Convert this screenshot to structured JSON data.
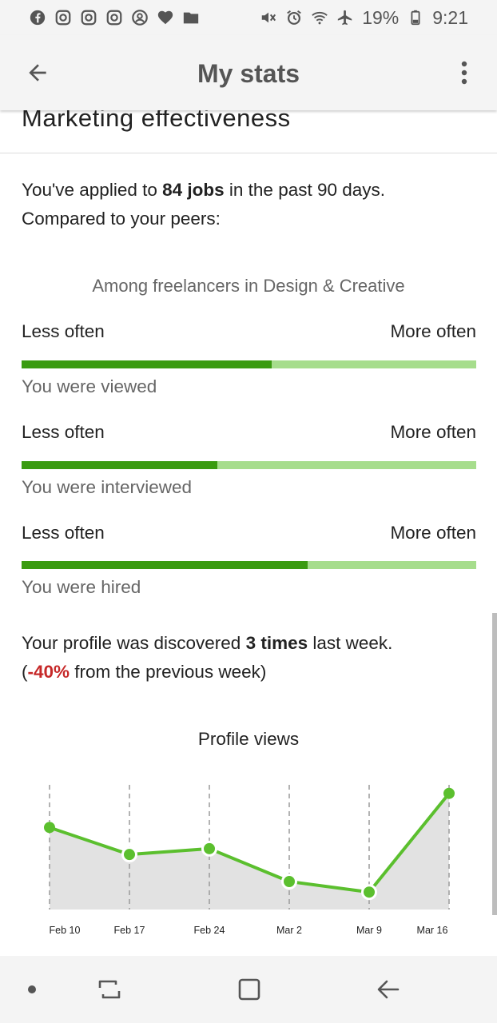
{
  "status_bar": {
    "battery": "19%",
    "time": "9:21",
    "left_icons": [
      "facebook-icon",
      "instagram-icon",
      "instagram-icon",
      "instagram-icon",
      "account-circle-icon",
      "heart-icon",
      "folder-icon"
    ],
    "right_icons": [
      "mute-icon",
      "alarm-icon",
      "wifi-icon",
      "airplane-icon",
      "battery-icon"
    ]
  },
  "app_bar": {
    "title": "My stats"
  },
  "section": {
    "title": "Marketing effectiveness"
  },
  "intro": {
    "prefix": "You've applied to ",
    "jobs": "84 jobs",
    "suffix": " in the past 90 days.",
    "line2": "Compared to your peers:"
  },
  "peers": {
    "caption": "Among freelancers in Design & Creative",
    "metrics": [
      {
        "low_label": "Less often",
        "high_label": "More often",
        "level": 0.55,
        "caption": "You were viewed"
      },
      {
        "low_label": "Less often",
        "high_label": "More often",
        "level": 0.43,
        "caption": "You were interviewed"
      },
      {
        "low_label": "Less often",
        "high_label": "More often",
        "level": 0.63,
        "caption": "You were hired"
      }
    ]
  },
  "discovered": {
    "prefix": "Your profile was discovered ",
    "times": "3 times",
    "suffix": " last week.",
    "open_paren": "(",
    "change": "-40%",
    "change_suffix": " from the previous week)"
  },
  "colors": {
    "bar_fill": "#3a9b10",
    "bar_track": "#a6dd8c",
    "line": "#5bbf2e",
    "negative": "#c62828"
  },
  "chart_data": {
    "type": "line",
    "title": "Profile views",
    "categories": [
      "Feb 10",
      "Feb 17",
      "Feb 24",
      "Mar 2",
      "Mar 9",
      "Mar 16"
    ],
    "values": [
      7.1,
      4.8,
      5.3,
      2.5,
      1.6,
      10.0
    ],
    "ylim": [
      -6,
      11
    ],
    "fill": "area",
    "grid": "vertical-dashed"
  }
}
